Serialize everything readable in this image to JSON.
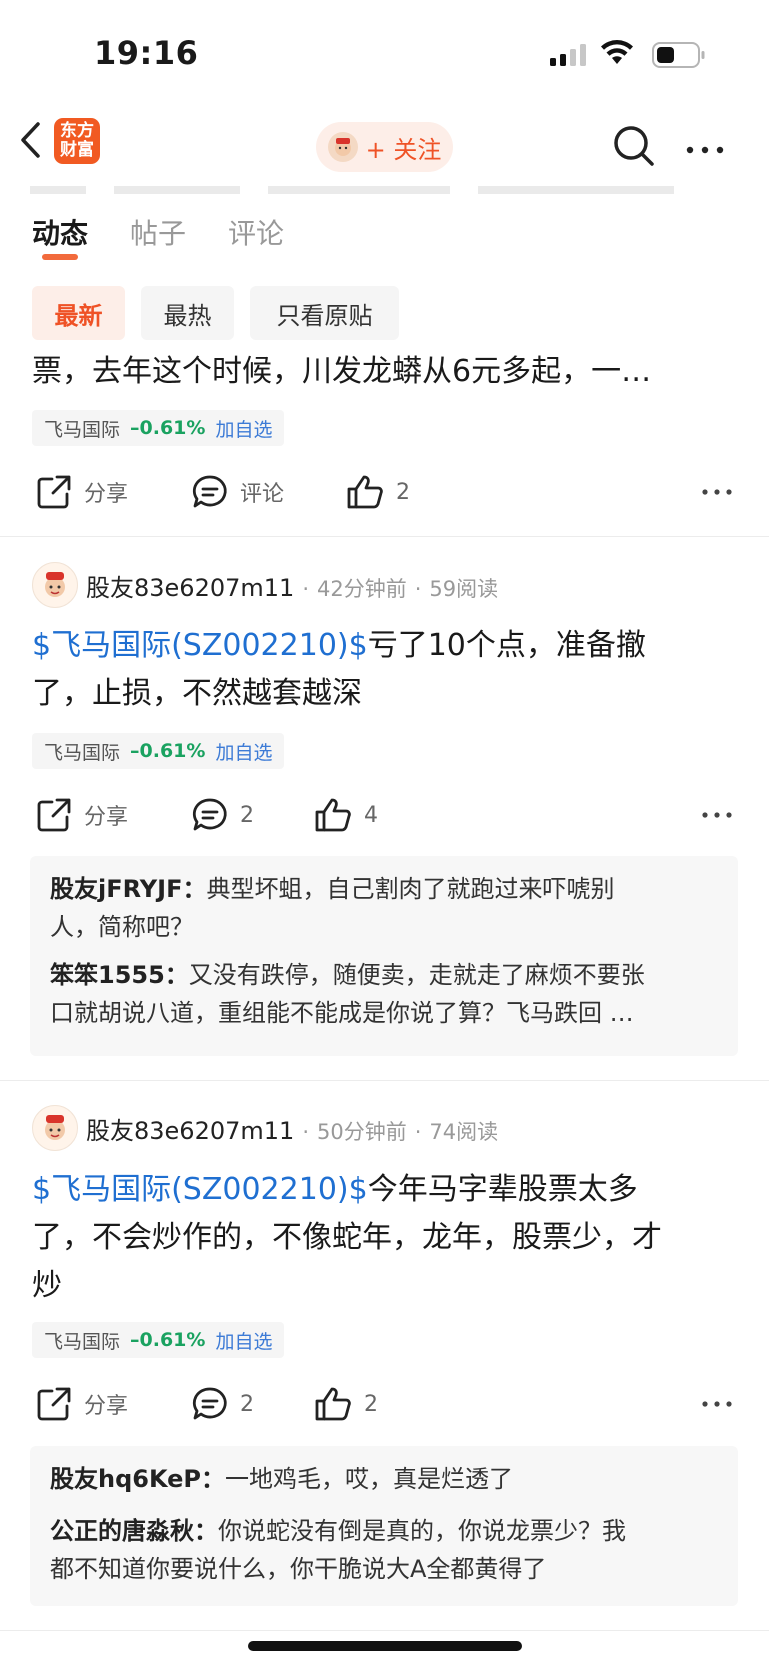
{
  "status_bar": {
    "time": "19:16"
  },
  "nav": {
    "logo_line1": "东方",
    "logo_line2": "财富",
    "follow_label": "+ 关注"
  },
  "tabs": [
    {
      "label": "动态"
    },
    {
      "label": "帖子"
    },
    {
      "label": "评论"
    }
  ],
  "filters": [
    {
      "label": "最新"
    },
    {
      "label": "最热"
    },
    {
      "label": "只看原贴"
    }
  ],
  "colors": {
    "accent": "#ef5226",
    "cashtag": "#1f6fd1",
    "down": "#1aa260",
    "link": "#3d7bd6"
  },
  "posts": [
    {
      "text_tail": "票，去年这个时候，川发龙蟒从6元多起，一…",
      "stock": {
        "name": "飞马国际",
        "change": "–0.61%",
        "add": "加自选"
      },
      "actions": {
        "share": "分享",
        "comment": "评论",
        "like": "2"
      }
    },
    {
      "user": "股友83e6207m11",
      "time": "42分钟前",
      "reads": "59阅读",
      "cashtag": "$飞马国际(SZ002210)$",
      "text1": "亏了10个点，准备撤",
      "text2": "了，止损，不然越套越深",
      "stock": {
        "name": "飞马国际",
        "change": "–0.61%",
        "add": "加自选"
      },
      "actions": {
        "share": "分享",
        "comment": "2",
        "like": "4"
      },
      "replies": [
        {
          "user": "股友jFRYJF：",
          "l1": "典型坏蛆，自己割肉了就跑过来吓唬别",
          "l2": "人，简称吧？"
        },
        {
          "user": "笨笨1555：",
          "l1": "又没有跌停，随便卖，走就走了麻烦不要张",
          "l2": "口就胡说八道，重组能不能成是你说了算？飞马跌回  …"
        }
      ]
    },
    {
      "user": "股友83e6207m11",
      "time": "50分钟前",
      "reads": "74阅读",
      "cashtag": "$飞马国际(SZ002210)$",
      "text1": "今年马字辈股票太多",
      "text2": "了，不会炒作的，不像蛇年，龙年，股票少，才",
      "text3": "炒",
      "stock": {
        "name": "飞马国际",
        "change": "–0.61%",
        "add": "加自选"
      },
      "actions": {
        "share": "分享",
        "comment": "2",
        "like": "2"
      },
      "replies": [
        {
          "user": "股友hq6KeP：",
          "l1": "一地鸡毛，哎，真是烂透了"
        },
        {
          "user": "公正的唐淼秋：",
          "l1": "你说蛇没有倒是真的，你说龙票少？我",
          "l2": "都不知道你要说什么，你干脆说大A全都黄得了"
        }
      ]
    }
  ]
}
